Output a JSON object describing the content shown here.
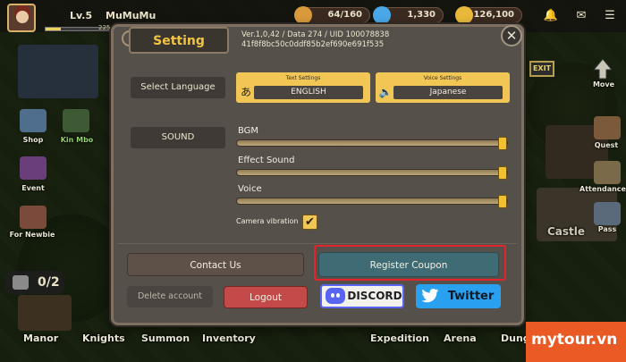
{
  "hud": {
    "level": "Lv.5",
    "player_name": "MuMuMu",
    "exp_fraction": 0.22,
    "exp_label": "225",
    "resources": [
      {
        "name": "stamina",
        "value": "64/160",
        "icon": "chest-icon",
        "color": "#d89a3a"
      },
      {
        "name": "gems",
        "value": "1,330",
        "icon": "gem-icon",
        "color": "#4aa8e8"
      },
      {
        "name": "gold",
        "value": "126,100",
        "icon": "coin-icon",
        "color": "#e8b83a"
      }
    ]
  },
  "left_menu": [
    "Shop",
    "Event",
    "For Newbie"
  ],
  "left_menu_partial": [
    "Kin Mbo"
  ],
  "right_menu": [
    "Move",
    "Quest",
    "Attendance",
    "Pass"
  ],
  "map_label": "Castle",
  "bottom_nav": [
    "Manor",
    "Knights",
    "Summon",
    "Inventory",
    "Expedition",
    "Arena",
    "Dunge"
  ],
  "badge_count": "0/2",
  "exit_sign": "EXIT",
  "dialog": {
    "title": "Setting",
    "version_line": "Ver.1,0,42 / Data 274 / UID 100078838",
    "uid_hash": "41f8f8bc50c0ddf85b2ef690e691f535",
    "language": {
      "row_label": "Select Language",
      "text_heading": "Text Settings",
      "text_value": "ENGLISH",
      "voice_heading": "Voice Settings",
      "voice_value": "Japanese"
    },
    "sound": {
      "row_label": "SOUND",
      "sliders": [
        {
          "label": "BGM",
          "level": 1.0
        },
        {
          "label": "Effect Sound",
          "level": 1.0
        },
        {
          "label": "Voice",
          "level": 1.0
        }
      ],
      "camera_vibration_label": "Camera vibration",
      "camera_vibration_checked": true
    },
    "buttons": {
      "contact": "Contact Us",
      "coupon": "Register Coupon",
      "delete": "Delete account",
      "logout": "Logout",
      "discord": "DISCORD",
      "twitter": "Twitter"
    }
  },
  "watermark": "mytour.vn"
}
